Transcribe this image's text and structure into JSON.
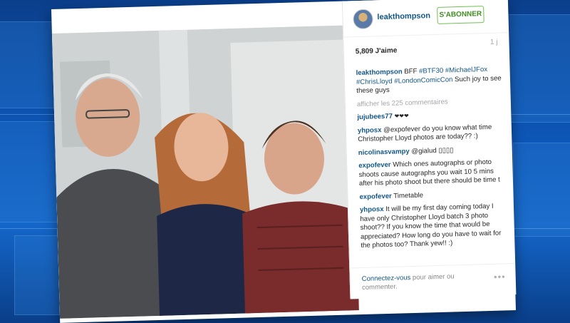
{
  "background": {
    "colors": [
      "#0b3f8c",
      "#0d57b8",
      "#1466c9"
    ]
  },
  "post": {
    "username": "leakthompson",
    "follow_label": "S'ABONNER",
    "likes": "5,809 J'aime",
    "time_ago": "1 j",
    "caption": {
      "user": "leakthompson",
      "parts": [
        "BFF ",
        "#BTF30",
        " ",
        "#MichaelJFox",
        " ",
        "#ChrisLloyd",
        " ",
        "#LondonComicCon",
        " Such joy to see these guys"
      ]
    },
    "view_all": "afficher les 225 commentaires",
    "comments": [
      {
        "user": "jujubees77",
        "text": "❤❤❤"
      },
      {
        "user": "yhposx",
        "text": "@expofever do you know what time Christopher Lloyd photos are today?? :)"
      },
      {
        "user": "nicolinasvampy",
        "text": "@gialud ▯▯▯▯"
      },
      {
        "user": "expofever",
        "text": "Which ones autographs or photo shoots cause autographs you wait 10 5 mins after his photo shoot but there should be time t"
      },
      {
        "user": "expofever",
        "text": "Timetable"
      },
      {
        "user": "yhposx",
        "text": "It will be my first day coming today I have only Christopher Lloyd batch 3 photo shoot?? If you know the time that would be appreciated? How long do you have to wait for the photos too? Thank yew!! :)"
      }
    ],
    "login_link": "Connectez-vous",
    "login_rest": " pour aimer ou commenter.",
    "more_dots": "•••"
  },
  "colors": {
    "link": "#125688",
    "follow_green": "#3f8e21",
    "muted": "#a5a7aa"
  }
}
